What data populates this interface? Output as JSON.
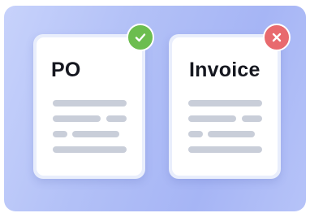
{
  "documents": [
    {
      "title": "PO",
      "status": "approved",
      "status_icon": "check-icon",
      "status_color": "#6cbd4f"
    },
    {
      "title": "Invoice",
      "status": "rejected",
      "status_icon": "close-icon",
      "status_color": "#e86a6e"
    }
  ],
  "colors": {
    "background_gradient": [
      "#c7d2fb",
      "#a6b5f5"
    ],
    "paper": "#ffffff",
    "paper_border": "#e9eefc",
    "placeholder_line": "#c9ced9",
    "title_text": "#15171f"
  }
}
